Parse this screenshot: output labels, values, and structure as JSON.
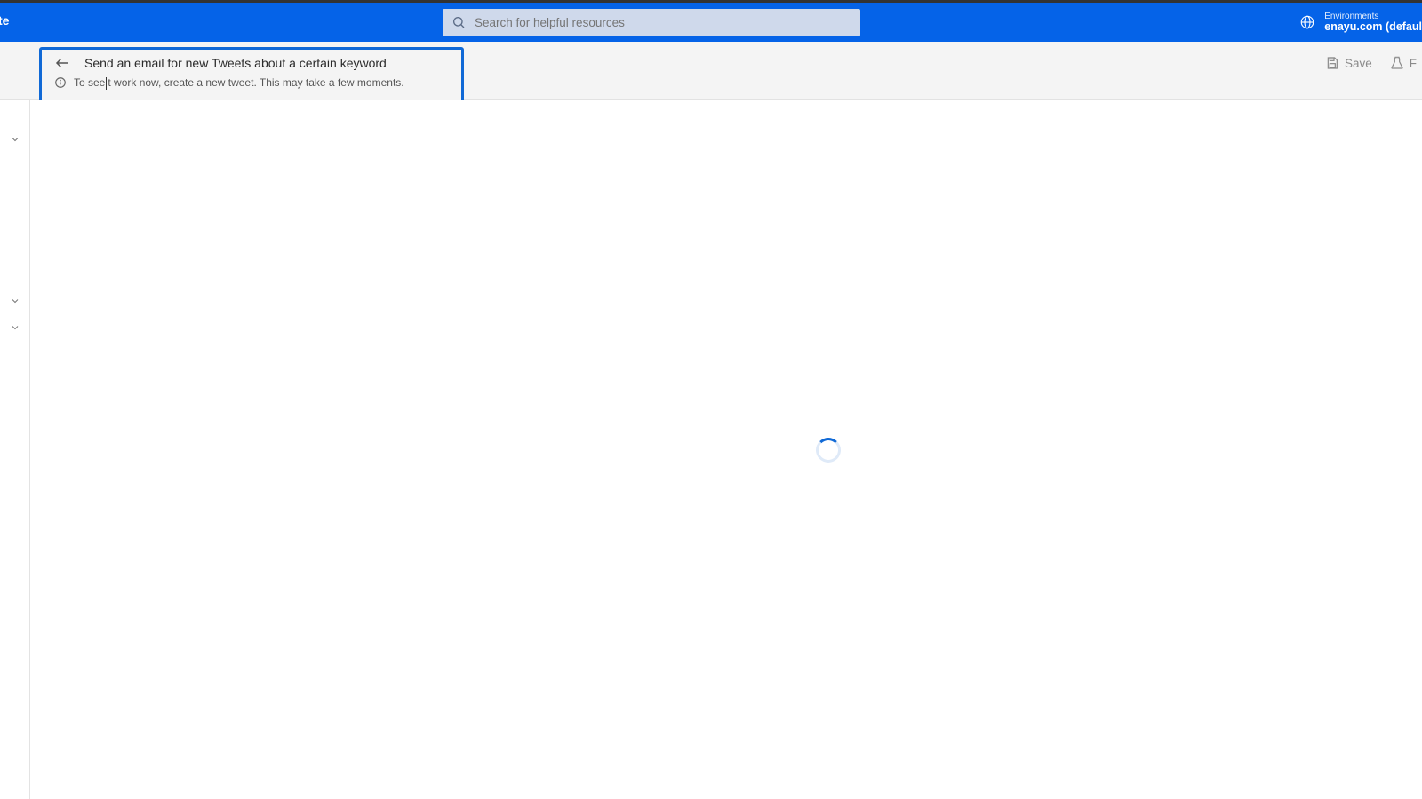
{
  "header": {
    "brand_fragment": "te",
    "search_placeholder": "Search for helpful resources",
    "env_label": "Environments",
    "env_name": "enayu.com (defaul"
  },
  "subheader": {
    "flow_title": "Send an email for new Tweets about a certain keyword",
    "hint_prefix": "To see",
    "hint_suffix": "t work now, create a new tweet. This may take a few moments."
  },
  "actions": {
    "save": "Save",
    "flow_checker_fragment": "F"
  },
  "icons": {
    "search": "search-icon",
    "globe": "globe-icon",
    "back": "back-arrow-icon",
    "info": "info-icon",
    "save": "save-icon",
    "checker": "flow-checker-icon",
    "chevron": "chevron-down-icon"
  }
}
